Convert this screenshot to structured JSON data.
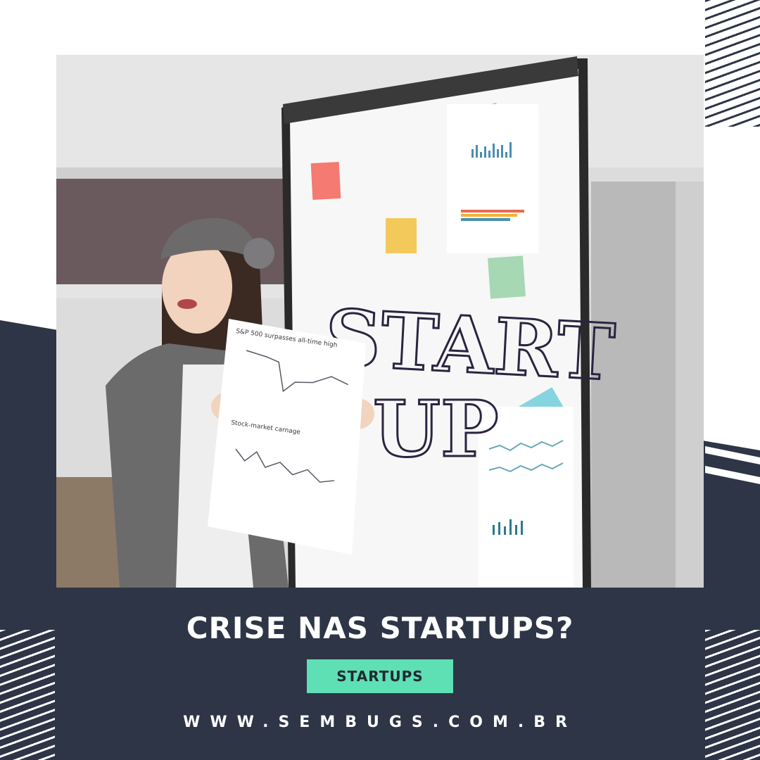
{
  "post": {
    "headline": "CRISE NAS STARTUPS?",
    "category_tag": "STARTUPS",
    "website": "WWW.SEMBUGS.COM.BR"
  },
  "photo": {
    "board_text_line1": "START",
    "board_text_line2": "UP",
    "paper_title_top": "S&P 500 surpasses all-time high",
    "paper_title_bottom": "Stock-market carnage"
  },
  "colors": {
    "dark_navy": "#2d3546",
    "accent_mint": "#5ee0b4",
    "white": "#ffffff"
  },
  "icons": [
    "stripe-pattern-icon"
  ]
}
